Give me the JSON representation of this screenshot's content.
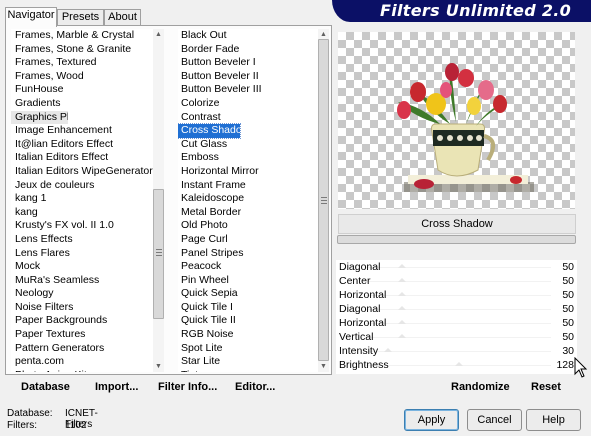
{
  "banner": {
    "title": "Filters Unlimited 2.0"
  },
  "tabs": [
    {
      "label": "Navigator",
      "active": true
    },
    {
      "label": "Presets",
      "active": false
    },
    {
      "label": "About",
      "active": false
    }
  ],
  "categories": [
    "Frames, Marble & Crystal",
    "Frames, Stone & Granite",
    "Frames, Textured",
    "Frames, Wood",
    "FunHouse",
    "Gradients",
    "Graphics Plus",
    "Image Enhancement",
    "It@lian Editors Effect",
    "Italian Editors Effect",
    "Italian Editors WipeGenerator",
    "Jeux de couleurs",
    "kang 1",
    "kang",
    "Krusty's FX vol. II 1.0",
    "Lens Effects",
    "Lens Flares",
    "Mock",
    "MuRa's Seamless",
    "Neology",
    "Noise Filters",
    "Paper Backgrounds",
    "Paper Textures",
    "Pattern Generators",
    "penta.com",
    "Photo Aging Kit"
  ],
  "category_selected": "Graphics Plus",
  "filters": [
    "Black Out",
    "Border Fade",
    "Button Beveler I",
    "Button Beveler II",
    "Button Beveler III",
    "Colorize",
    "Contrast",
    "Cross Shadow",
    "Cut Glass",
    "Emboss",
    "Horizontal Mirror",
    "Instant Frame",
    "Kaleidoscope",
    "Metal Border",
    "Old Photo",
    "Page Curl",
    "Panel Stripes",
    "Peacock",
    "Pin Wheel",
    "Quick Sepia",
    "Quick Tile I",
    "Quick Tile II",
    "RGB Noise",
    "Spot Lite",
    "Star Lite",
    "Tint"
  ],
  "filter_selected": "Cross Shadow",
  "toolbar": {
    "database": "Database",
    "import": "Import...",
    "filter_info": "Filter Info...",
    "editor": "Editor..."
  },
  "preview": {
    "filter_name": "Cross Shadow"
  },
  "params": [
    {
      "label": "Diagonal",
      "value": 50
    },
    {
      "label": "Center",
      "value": 50
    },
    {
      "label": "Horizontal",
      "value": 50
    },
    {
      "label": "Diagonal",
      "value": 50
    },
    {
      "label": "Horizontal",
      "value": 50
    },
    {
      "label": "Vertical",
      "value": 50
    },
    {
      "label": "Intensity",
      "value": 30
    },
    {
      "label": "Brightness",
      "value": 128
    }
  ],
  "param_max": 255,
  "actions": {
    "randomize": "Randomize",
    "reset": "Reset"
  },
  "status": {
    "database_label": "Database:",
    "database_value": "ICNET-Filters",
    "filters_label": "Filters:",
    "filters_value": "1102"
  },
  "buttons": {
    "apply": "Apply",
    "cancel": "Cancel",
    "help": "Help"
  },
  "colors": {
    "banner": "#0b1066",
    "selection": "#1f6fd3"
  }
}
